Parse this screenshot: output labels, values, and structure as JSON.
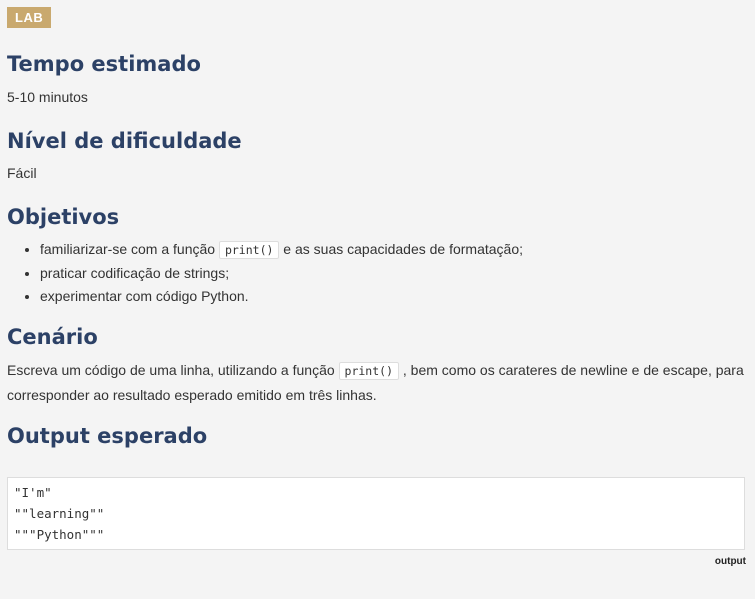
{
  "badge": "LAB",
  "sections": {
    "tempo": {
      "title": "Tempo estimado",
      "text": "5-10 minutos"
    },
    "nivel": {
      "title": "Nível de dificuldade",
      "text": "Fácil"
    },
    "objetivos": {
      "title": "Objetivos",
      "items": [
        {
          "before": "familiarizar-se com a função ",
          "code": "print()",
          "after": " e as suas capacidades de formatação;"
        },
        {
          "text": "praticar codificação de strings;"
        },
        {
          "text": "experimentar com código Python."
        }
      ]
    },
    "cenario": {
      "title": "Cenário",
      "before": "Escreva um código de uma linha, utilizando a função ",
      "code": "print()",
      "after": " , bem como os carateres de newline e de escape, para corresponder ao resultado esperado emitido em três linhas."
    },
    "output": {
      "title": "Output esperado",
      "lines": [
        "\"I'm\"",
        "\"\"learning\"\"",
        "\"\"\"Python\"\"\""
      ],
      "caption": "output"
    }
  }
}
